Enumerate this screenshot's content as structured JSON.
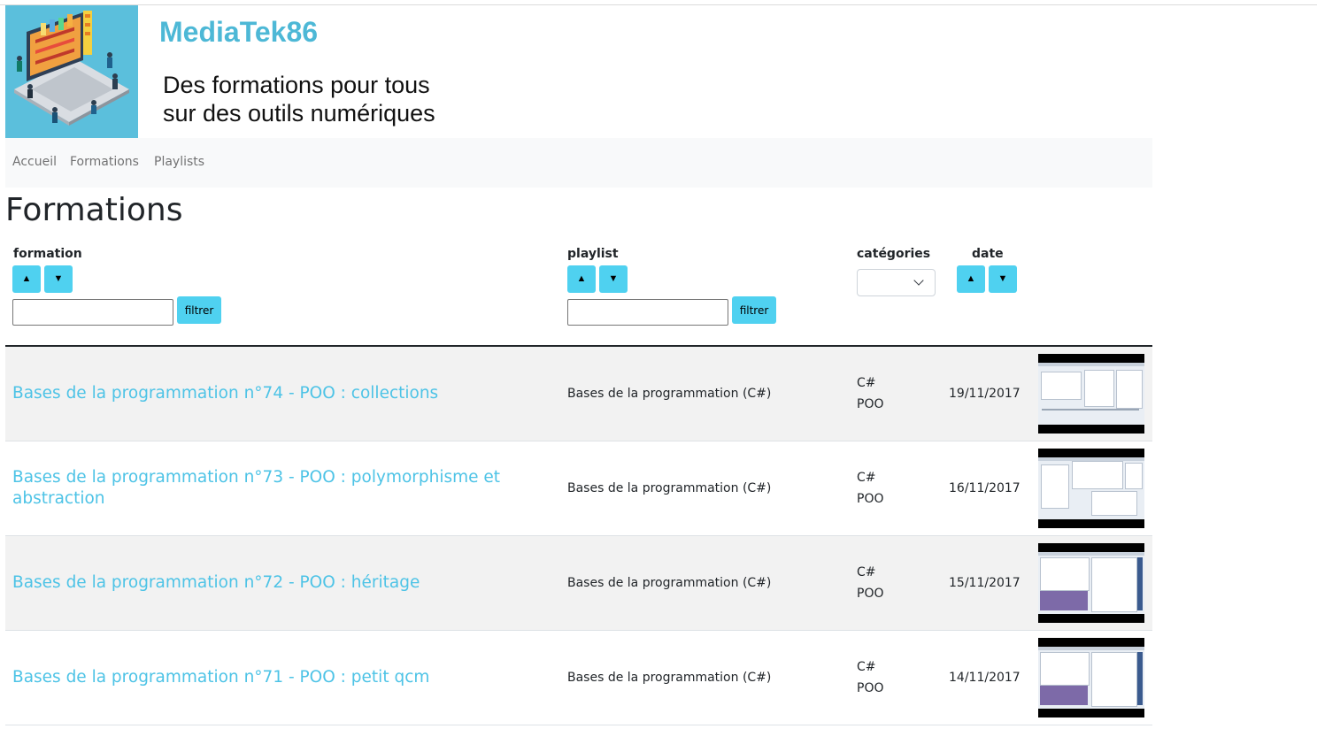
{
  "header": {
    "site_title": "MediaTek86",
    "tagline_line1": "Des formations pour tous",
    "tagline_line2": "sur des outils numériques",
    "logo_icon": "laptop-library-illustration"
  },
  "nav": {
    "items": [
      {
        "label": "Accueil"
      },
      {
        "label": "Formations"
      },
      {
        "label": "Playlists"
      }
    ]
  },
  "page": {
    "title": "Formations"
  },
  "table": {
    "headers": {
      "formation": "formation",
      "playlist": "playlist",
      "categories": "catégories",
      "date": "date"
    },
    "sort_up_icon": "triangle-up-icon",
    "sort_down_icon": "triangle-down-icon",
    "filter_label": "filtrer",
    "formation_filter_value": "",
    "playlist_filter_value": "",
    "categories_selected": "",
    "accent_color": "#4fd1f0",
    "link_color": "#4dc3e6",
    "rows": [
      {
        "title": "Bases de la programmation n°74 - POO : collections",
        "playlist": "Bases de la programmation (C#)",
        "categories": [
          "C#",
          "POO"
        ],
        "date": "19/11/2017"
      },
      {
        "title": "Bases de la programmation n°73 - POO : polymorphisme et abstraction",
        "playlist": "Bases de la programmation (C#)",
        "categories": [
          "C#",
          "POO"
        ],
        "date": "16/11/2017"
      },
      {
        "title": "Bases de la programmation n°72 - POO : héritage",
        "playlist": "Bases de la programmation (C#)",
        "categories": [
          "C#",
          "POO"
        ],
        "date": "15/11/2017"
      },
      {
        "title": "Bases de la programmation n°71 - POO : petit qcm",
        "playlist": "Bases de la programmation (C#)",
        "categories": [
          "C#",
          "POO"
        ],
        "date": "14/11/2017"
      }
    ]
  }
}
